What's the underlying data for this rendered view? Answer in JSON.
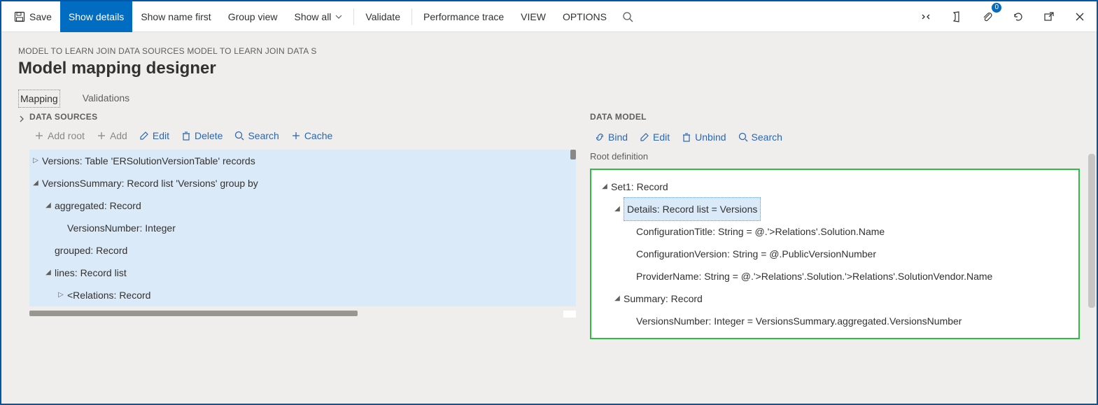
{
  "toolbar": {
    "save": "Save",
    "show_details": "Show details",
    "show_name_first": "Show name first",
    "group_view": "Group view",
    "show_all": "Show all",
    "validate": "Validate",
    "perf_trace": "Performance trace",
    "view": "VIEW",
    "options": "OPTIONS",
    "attach_badge": "0"
  },
  "breadcrumb": "MODEL TO LEARN JOIN DATA SOURCES MODEL TO LEARN JOIN DATA S",
  "page_title": "Model mapping designer",
  "tabs": {
    "mapping": "Mapping",
    "validations": "Validations"
  },
  "ds": {
    "header": "DATA SOURCES",
    "add_root": "Add root",
    "add": "Add",
    "edit": "Edit",
    "delete": "Delete",
    "search": "Search",
    "cache": "Cache",
    "tree": {
      "versions": "Versions: Table 'ERSolutionVersionTable' records",
      "versions_summary": "VersionsSummary: Record list 'Versions' group by",
      "aggregated": "aggregated: Record",
      "versions_number": "VersionsNumber: Integer",
      "grouped": "grouped: Record",
      "lines": "lines: Record list",
      "relations": "<Relations: Record"
    }
  },
  "dm": {
    "header": "DATA MODEL",
    "bind": "Bind",
    "edit": "Edit",
    "unbind": "Unbind",
    "search": "Search",
    "root_def": "Root definition",
    "tree": {
      "set1": "Set1: Record",
      "details": "Details: Record list = Versions",
      "conf_title": "ConfigurationTitle: String = @.'>Relations'.Solution.Name",
      "conf_version": "ConfigurationVersion: String = @.PublicVersionNumber",
      "provider": "ProviderName: String = @.'>Relations'.Solution.'>Relations'.SolutionVendor.Name",
      "summary": "Summary: Record",
      "versions_number": "VersionsNumber: Integer = VersionsSummary.aggregated.VersionsNumber"
    }
  }
}
